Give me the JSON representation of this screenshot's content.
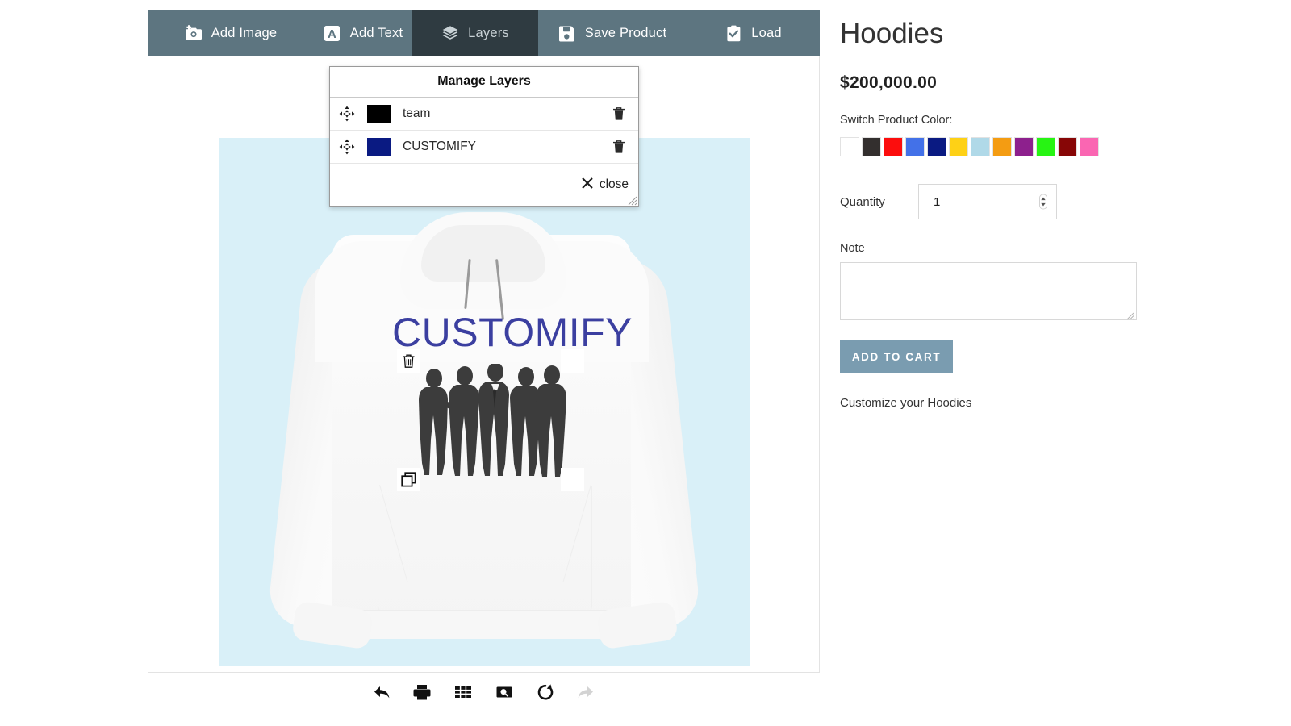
{
  "toolbar": {
    "tabs": [
      {
        "id": "add-image",
        "label": "Add Image",
        "icon": "camera-plus-icon",
        "active": false
      },
      {
        "id": "add-text",
        "label": "Add Text",
        "icon": "letter-a-icon",
        "active": false
      },
      {
        "id": "layers",
        "label": "Layers",
        "icon": "layers-stack-icon",
        "active": true
      },
      {
        "id": "save-product",
        "label": "Save Product",
        "icon": "floppy-disk-icon",
        "active": false
      },
      {
        "id": "load",
        "label": "Load",
        "icon": "clipboard-check-icon",
        "active": false
      }
    ],
    "active_bg": "#2f3b41",
    "bar_bg": "#5d7580"
  },
  "layers_panel": {
    "title": "Manage Layers",
    "rows": [
      {
        "name": "team",
        "swatch": "#000000",
        "move_icon": "move-arrows-icon",
        "delete_icon": "trash-icon"
      },
      {
        "name": "CUSTOMIFY",
        "swatch": "#0a1a82",
        "move_icon": "move-arrows-icon",
        "delete_icon": "trash-icon"
      }
    ],
    "close_label": "close",
    "close_icon": "close-x-icon"
  },
  "canvas": {
    "background": "#d9f0f8",
    "product_color": "#ffffff",
    "design_text": "CUSTOMIFY",
    "design_text_color": "#3b3fa0",
    "selected_layer": "team",
    "selection_delete_icon": "trash-icon",
    "selection_duplicate_icon": "duplicate-icon"
  },
  "bottom_toolbar": {
    "buttons": [
      {
        "id": "undo",
        "icon": "undo-arrow-icon",
        "disabled": false
      },
      {
        "id": "print",
        "icon": "printer-icon",
        "disabled": false
      },
      {
        "id": "grid",
        "icon": "grid-icon",
        "disabled": false
      },
      {
        "id": "preview",
        "icon": "zoom-preview-icon",
        "disabled": false
      },
      {
        "id": "reset",
        "icon": "refresh-icon",
        "disabled": false
      },
      {
        "id": "redo",
        "icon": "redo-arrow-icon",
        "disabled": true
      }
    ]
  },
  "product": {
    "title": "Hoodies",
    "price": "$200,000.00",
    "color_label": "Switch Product Color:",
    "colors": [
      {
        "name": "white",
        "hex": "#ffffff",
        "selected": true
      },
      {
        "name": "black",
        "hex": "#332f2e",
        "selected": false
      },
      {
        "name": "red",
        "hex": "#fc0d0d",
        "selected": false
      },
      {
        "name": "royal-blue",
        "hex": "#4371e8",
        "selected": false
      },
      {
        "name": "navy",
        "hex": "#0a1a82",
        "selected": false
      },
      {
        "name": "yellow",
        "hex": "#fed116",
        "selected": false
      },
      {
        "name": "light-blue",
        "hex": "#b0d9e8",
        "selected": false
      },
      {
        "name": "orange",
        "hex": "#f49c12",
        "selected": false
      },
      {
        "name": "purple",
        "hex": "#8d208d",
        "selected": false
      },
      {
        "name": "green",
        "hex": "#27f413",
        "selected": false
      },
      {
        "name": "maroon",
        "hex": "#870606",
        "selected": false
      },
      {
        "name": "pink",
        "hex": "#fa66b2",
        "selected": false
      }
    ],
    "quantity_label": "Quantity",
    "quantity_value": "1",
    "note_label": "Note",
    "note_value": "",
    "note_placeholder": "",
    "add_to_cart_label": "ADD TO CART",
    "add_to_cart_color": "#7a9cb0",
    "customize_text": "Customize your Hoodies"
  }
}
